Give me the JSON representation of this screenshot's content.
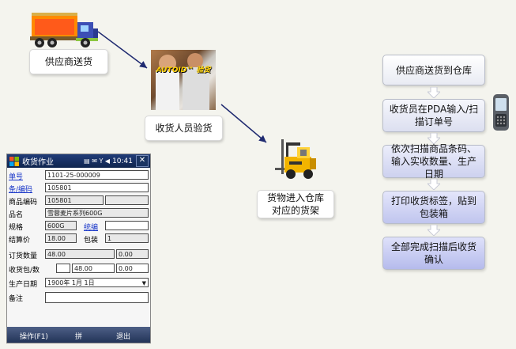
{
  "captions": {
    "supplier_delivery": "供应商送货",
    "receiver_inspect": "收货人员验货",
    "goods_to_shelf": "货物进入仓库对应的货架",
    "photo_banner": "AUTOID™ 验货"
  },
  "flow_steps": [
    "供应商送货到仓库",
    "收货员在PDA输入/扫描订单号",
    "依次扫描商品条码、输入实收数量、生产日期",
    "打印收货标签，贴到包装箱",
    "全部完成扫描后收货确认"
  ],
  "pda": {
    "title": "收货作业",
    "status": "10:41",
    "fields": {
      "order_no_label": "单号",
      "order_no": "1101-25-000009",
      "barcode_label": "条/编码",
      "barcode": "105801",
      "product_code_label": "商品编码",
      "product_code": "105801",
      "product_name_label": "品名",
      "product_name": "雪蓉麦片系列600G",
      "spec_label": "规格",
      "spec": "600G",
      "unit_label": "统编",
      "unit": "",
      "price_label": "结算价",
      "price": "18.00",
      "pack_label": "包装",
      "pack": "1",
      "order_qty_label": "订货数量",
      "order_qty": "48.00",
      "order_qty2": "0.00",
      "recv_label": "收货包/数",
      "recv_pack": "",
      "recv_qty": "48.00",
      "recv_qty2": "0.00",
      "prod_date_label": "生产日期",
      "prod_date": "1900年 1月 1日",
      "remark_label": "备注",
      "remark": ""
    },
    "softkeys": {
      "left": "操作(F1)",
      "middle": "拼",
      "right": "退出"
    }
  }
}
